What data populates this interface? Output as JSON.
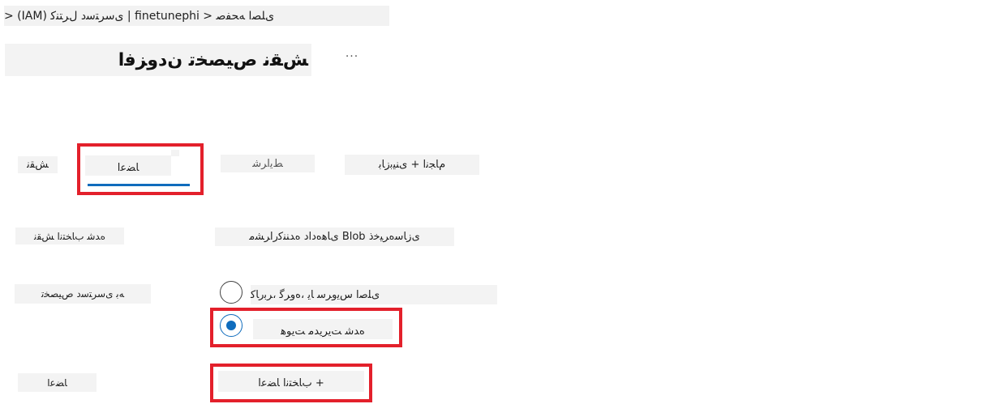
{
  "breadcrumb": {
    "text": "ﻯﻠﺼﺍ ﻪﺤﻔﺻ < finetunephi | ﻯﺳﺮﺘﺳﺩ ﻝﺮﺘﻨﮐ (IAM) <"
  },
  "header": {
    "title": "ﺶﻘﻧ ﺹﯿﺼﺨﺗ ﻥﺩﻭﺰﻓﺍ",
    "more_label": "···"
  },
  "tabs": [
    {
      "label": "ﺶﻘﻧ"
    },
    {
      "label": "ﺎﻀﻋﺍ",
      "selected": true
    },
    {
      "label": "ﻂﯾﺍﺮﺷ"
    },
    {
      "label": "ﻡﺎﺠﻧﺍ + ﻯﻨﯿﺑﺯﺎﺑ"
    }
  ],
  "form": {
    "selected_role_label": "ﻩﺪﺷ ﺏﺎﺨﺘﻧﺍ ﺶﻘﻧ",
    "selected_role_value": "ﻯﺯﺎﺳﻩﺮﯿﺧﺫ Blob ﻯﺎﻫﻩﺩﺍﺩ ﻩﺪﻨﻨﮐﺭﺍﺮﺸﻣ",
    "assign_access_label": "ﻪﺑ ﻯﺳﺮﺘﺳﺩ ﺹﯿﺼﺨﺗ",
    "options": [
      {
        "label": "ﻯﻠﺻﺍ ﺱﯾﻭﺮﺳ ﺎﯾ ،ﻩﻭﺮﮔ ،ﺮﺑﺭﺎﮐ",
        "checked": false
      },
      {
        "label": "ﻩﺪﺷ ﺖﯾﺮﯾﺪﻣ ﺖﯾﻮﻫ",
        "checked": true
      }
    ],
    "members_label": "ﺎﻀﻋﺍ",
    "select_members_label": "+ ﺏﺎﺨﺘﻧﺍ ﺎﻀﻋﺍ"
  },
  "colors": {
    "accent": "#0f6cbd",
    "highlight": "#e3202b",
    "placeholder_bg": "#f3f3f3"
  }
}
